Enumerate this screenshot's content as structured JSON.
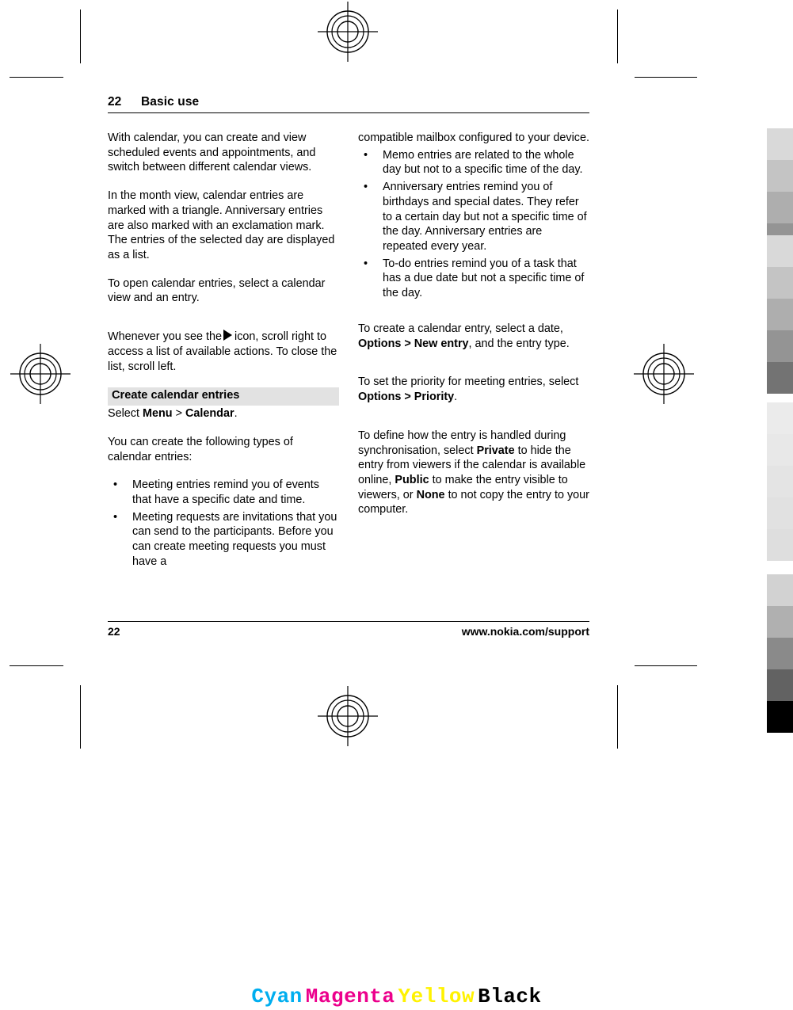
{
  "header": {
    "page_number": "22",
    "section_title": "Basic use"
  },
  "left_column": {
    "paragraph_1": "With calendar, you can create and view scheduled events and appointments, and switch between different calendar views.",
    "paragraph_2": "In the month view, calendar entries are marked with a triangle. Anniversary entries are also marked with an exclamation mark. The entries of the selected day are displayed as a list.",
    "paragraph_3": "To open calendar entries, select a calendar view and an entry.",
    "paragraph_4_before_icon": "Whenever you see the",
    "icon_name": "right-arrow-triangle-icon",
    "paragraph_4_after_icon": "icon, scroll right to access a list of available actions. To close the list, scroll left.",
    "section_heading": "Create calendar entries",
    "select_label": "Select",
    "select_menu": "Menu",
    "select_separator": ">",
    "select_calendar": "Calendar",
    "select_period": ".",
    "paragraph_5": "You can create the following types of calendar entries:",
    "bullets": [
      "Meeting entries remind you of events that have a specific date and time.",
      "Meeting requests are invitations that you can send to the participants. Before you can create meeting requests you must have a"
    ],
    "bullet_marker": "•"
  },
  "right_column": {
    "continuation": "compatible mailbox configured to your device.",
    "bullets": [
      "Memo entries are related to the whole day but not to a specific time of the day.",
      "Anniversary entries remind you of birthdays and special dates. They refer to a certain day but not a specific time of the day. Anniversary entries are repeated every year.",
      "To-do entries remind you of a task that has a due date but not a specific time of the day."
    ],
    "bullet_marker": "•",
    "paragraph_create": {
      "text_1": "To create a calendar entry, select a date,",
      "bold_1": "Options",
      "separator": ">",
      "bold_2": "New entry",
      "text_2": ", and the entry type."
    },
    "paragraph_priority": {
      "text_1": "To set the priority for meeting entries, select",
      "bold_1": "Options",
      "separator": ">",
      "bold_2": "Priority",
      "text_2": "."
    },
    "paragraph_sync": {
      "text_1": "To define how the entry is handled during synchronisation, select",
      "bold_1": "Private",
      "text_2": "to hide the entry from viewers if the calendar is available online,",
      "bold_2": "Public",
      "text_3": "to make the entry visible to viewers, or",
      "bold_3": "None",
      "text_4": "to not copy the entry to your computer."
    }
  },
  "footer": {
    "page_number": "22",
    "support_url": "www.nokia.com/support"
  },
  "color_bar": {
    "cyan_label": "Cyan",
    "magenta_label": "Magenta",
    "yellow_label": "Yellow",
    "black_label": "Black",
    "cyan_hex": "#00AEEF",
    "magenta_hex": "#EC008C",
    "yellow_hex": "#FFF200",
    "black_hex": "#000000"
  },
  "calibration": {
    "strip_1": [
      "#d9d9d9",
      "#c4c4c4",
      "#aeaeae",
      "#949494",
      "#757575"
    ],
    "strip_2": [
      "#d9d9d9",
      "#c4c4c4",
      "#aeaeae",
      "#949494",
      "#737373"
    ],
    "strip_3": [
      "#ebebeb",
      "#e8e8e8",
      "#e4e4e4",
      "#e1e1e1",
      "#dedede"
    ],
    "strip_4": [
      "#d2d2d2",
      "#b0b0b0",
      "#8a8a8a",
      "#626262",
      "#000000"
    ]
  }
}
